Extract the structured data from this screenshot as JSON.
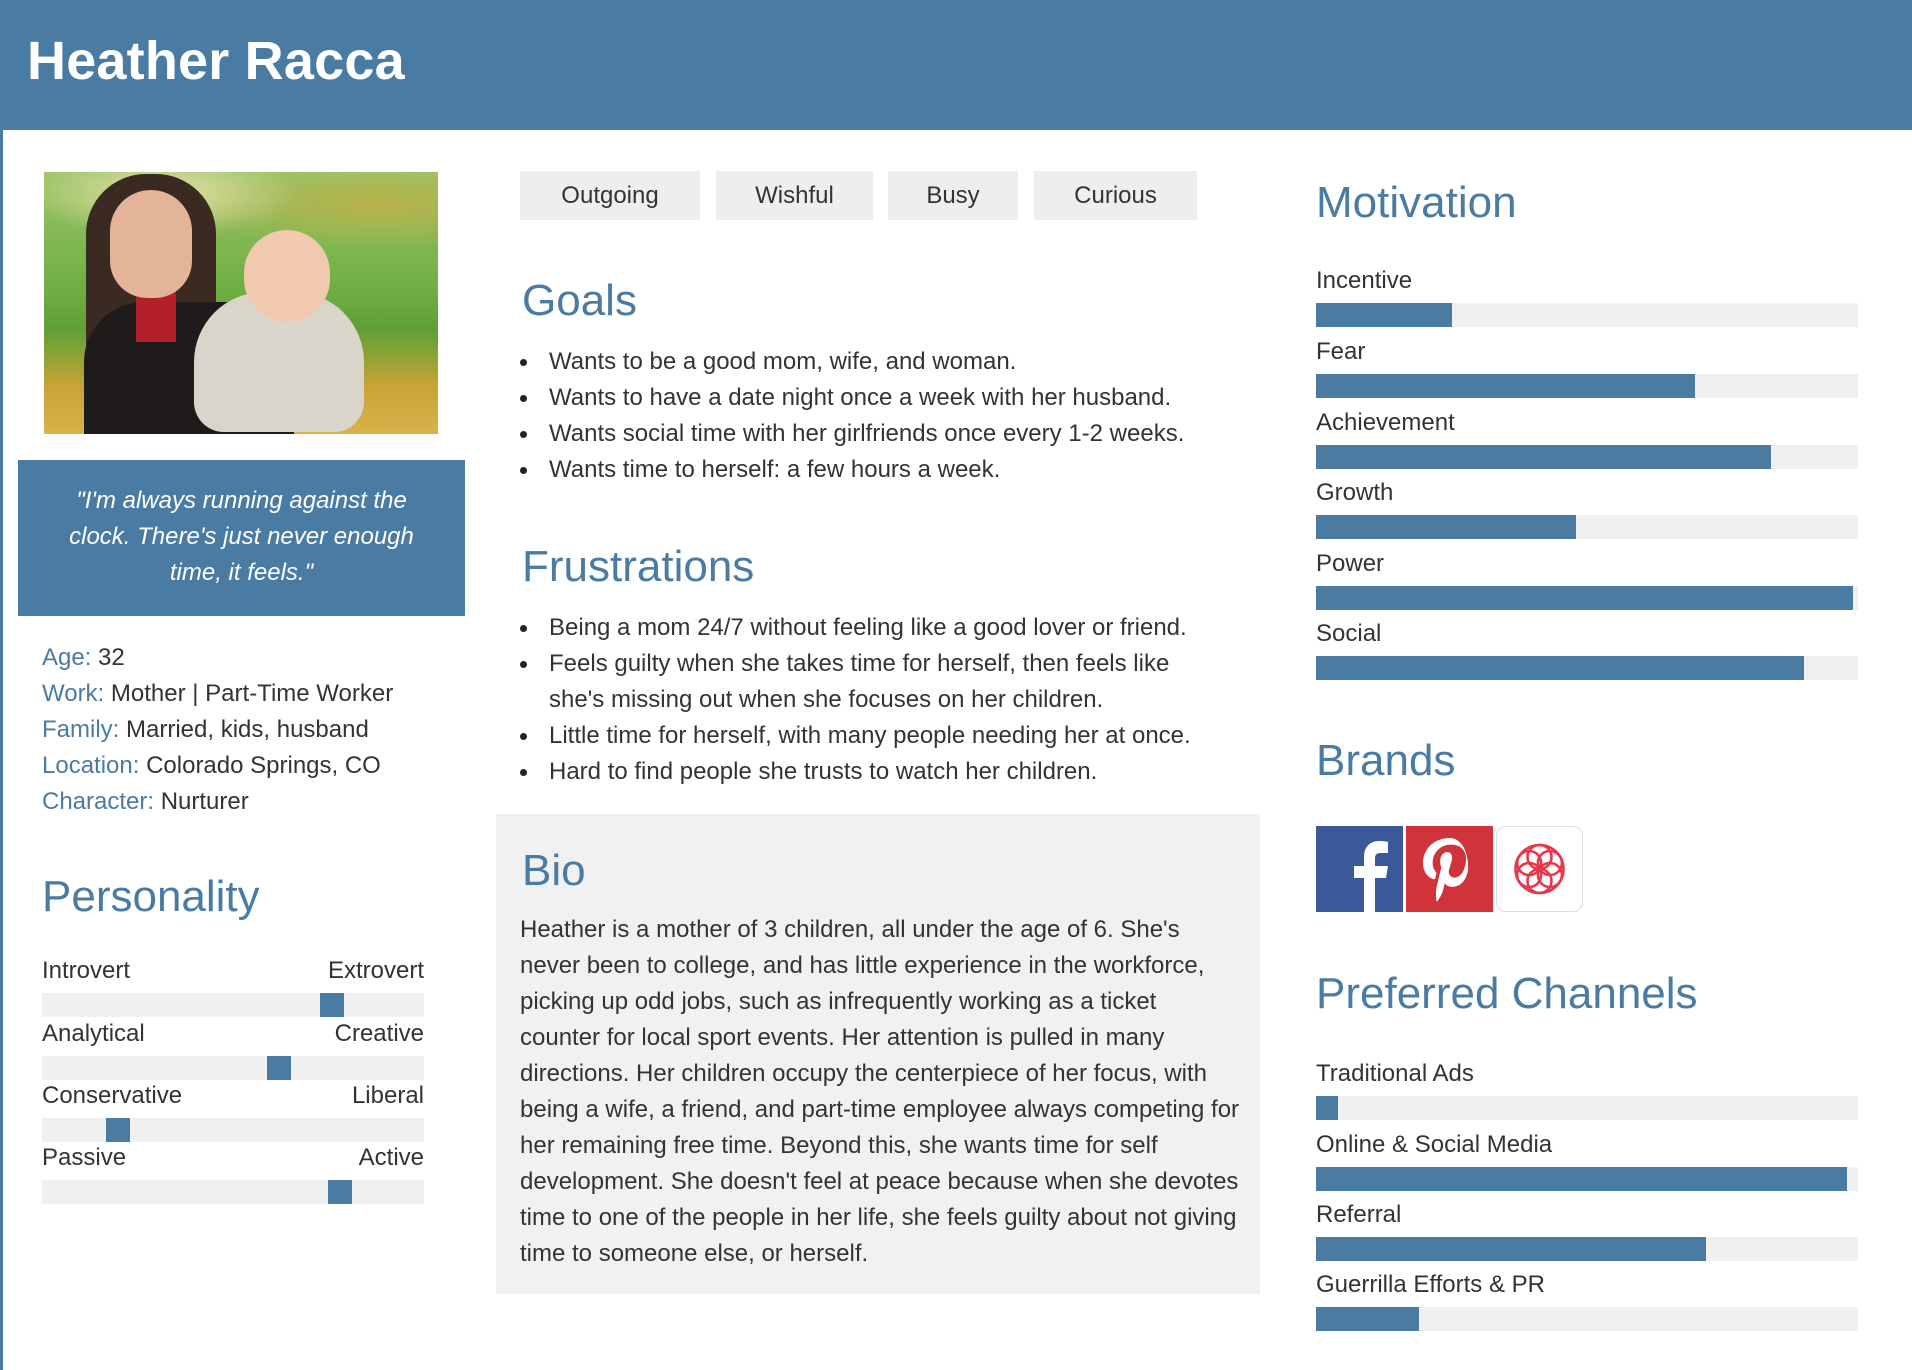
{
  "persona": {
    "name": "Heather Racca",
    "quote": "\"I'm always running against the clock. There's just never enough time, it feels.\"",
    "facts": [
      {
        "key": "Age:",
        "value": "32"
      },
      {
        "key": "Work:",
        "value": "Mother | Part-Time Worker"
      },
      {
        "key": "Family:",
        "value": "Married, kids, husband"
      },
      {
        "key": "Location:",
        "value": "Colorado Springs, CO"
      },
      {
        "key": "Character:",
        "value": "Nurturer"
      }
    ]
  },
  "personality": {
    "title": "Personality",
    "scales": [
      {
        "left": "Introvert",
        "right": "Extrovert",
        "value": 0.76
      },
      {
        "left": "Analytical",
        "right": "Creative",
        "value": 0.62
      },
      {
        "left": "Conservative",
        "right": "Liberal",
        "value": 0.2
      },
      {
        "left": "Passive",
        "right": "Active",
        "value": 0.78
      }
    ]
  },
  "tags": [
    "Outgoing",
    "Wishful",
    "Busy",
    "Curious"
  ],
  "goals": {
    "title": "Goals",
    "items": [
      "Wants to be a good mom, wife, and woman.",
      "Wants to have a date night once a week with her husband.",
      "Wants social time with her girlfriends once every 1-2 weeks.",
      "Wants time to herself: a few hours a week."
    ]
  },
  "frustrations": {
    "title": "Frustrations",
    "items": [
      "Being a mom 24/7 without feeling like a good lover or friend.",
      "Feels guilty when she takes time for herself, then feels like she's missing out when she focuses on her children.",
      "Little time for herself, with many people needing her at once.",
      "Hard to find people she trusts to watch her children."
    ]
  },
  "bio": {
    "title": "Bio",
    "text": "Heather is a mother of 3 children, all under the age of 6. She's never been to college, and has little experience in the workforce, picking up odd jobs, such as infrequently working as a ticket counter for local sport events. Her attention is pulled in many directions. Her children occupy the centerpiece of her focus, with being a wife, a friend, and part-time employee always competing for her remaining free time. Beyond this, she wants time for self development. She doesn't feel at peace because when she devotes time to one of the people in her life, she feels guilty about not giving time to someone else, or herself."
  },
  "motivation": {
    "title": "Motivation",
    "items": [
      {
        "label": "Incentive",
        "value": 0.25
      },
      {
        "label": "Fear",
        "value": 0.7
      },
      {
        "label": "Achievement",
        "value": 0.84
      },
      {
        "label": "Growth",
        "value": 0.48
      },
      {
        "label": "Power",
        "value": 0.99
      },
      {
        "label": "Social",
        "value": 0.9
      }
    ]
  },
  "brands": {
    "title": "Brands",
    "items": [
      {
        "icon": "facebook-logo-icon",
        "color": "#3b5998"
      },
      {
        "icon": "pinterest-logo-icon",
        "color": "#d1333a"
      },
      {
        "icon": "clue-logo-icon",
        "color": "#e8364a"
      }
    ]
  },
  "channels": {
    "title": "Preferred Channels",
    "items": [
      {
        "label": "Traditional Ads",
        "value": 0.04
      },
      {
        "label": "Online & Social Media",
        "value": 0.98
      },
      {
        "label": "Referral",
        "value": 0.72
      },
      {
        "label": "Guerrilla Efforts & PR",
        "value": 0.19
      }
    ]
  },
  "colors": {
    "accent": "#4a7ba3",
    "track": "#f0f0f0",
    "panel": "#f1f1f1",
    "tag": "#eeeeee"
  }
}
